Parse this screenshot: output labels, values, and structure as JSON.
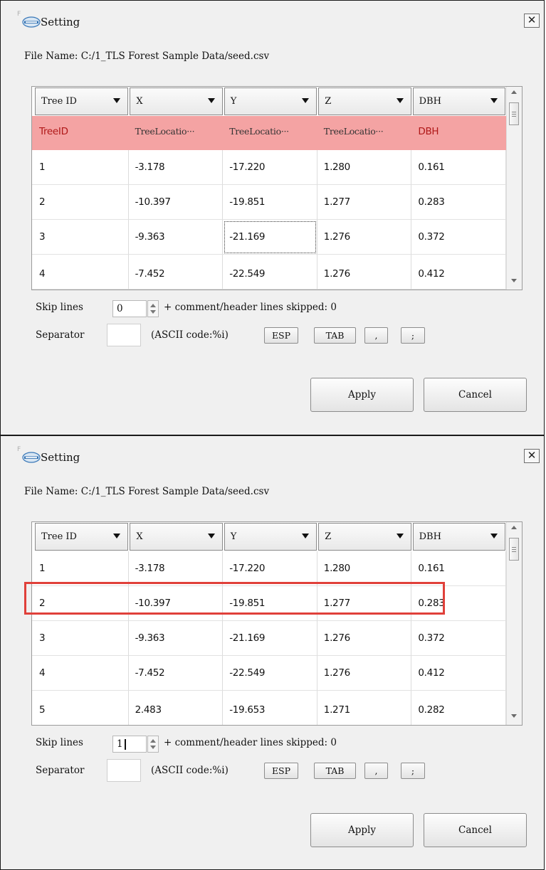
{
  "dialogs": [
    {
      "corner_mark": "F",
      "title": "Setting",
      "file_label": "File Name:",
      "file_path": "C:/1_TLS Forest Sample Data/seed.csv",
      "columns": [
        "Tree ID",
        "X",
        "Y",
        "Z",
        "DBH"
      ],
      "mapping_row": [
        "TreeID",
        "TreeLocatio···",
        "TreeLocatio···",
        "TreeLocatio···",
        "DBH"
      ],
      "rows": [
        [
          "1",
          "-3.178",
          "-17.220",
          "1.280",
          "0.161"
        ],
        [
          "2",
          "-10.397",
          "-19.851",
          "1.277",
          "0.283"
        ],
        [
          "3",
          "-9.363",
          "-21.169",
          "1.276",
          "0.372"
        ],
        [
          "4",
          "-7.452",
          "-22.549",
          "1.276",
          "0.412"
        ]
      ],
      "skip_label": "Skip lines",
      "skip_value": "0",
      "skip_note": "+ comment/header lines skipped: 0",
      "separator_label": "Separator",
      "separator_value": "",
      "ascii_label": "(ASCII code:%i)",
      "sep_buttons": [
        "ESP",
        "TAB",
        ",",
        ";"
      ],
      "apply_label": "Apply",
      "cancel_label": "Cancel",
      "close_glyph": "✕"
    },
    {
      "corner_mark": "F",
      "title": "Setting",
      "file_label": "File Name:",
      "file_path": "C:/1_TLS Forest Sample Data/seed.csv",
      "columns": [
        "Tree ID",
        "X",
        "Y",
        "Z",
        "DBH"
      ],
      "rows": [
        [
          "1",
          "-3.178",
          "-17.220",
          "1.280",
          "0.161"
        ],
        [
          "2",
          "-10.397",
          "-19.851",
          "1.277",
          "0.283"
        ],
        [
          "3",
          "-9.363",
          "-21.169",
          "1.276",
          "0.372"
        ],
        [
          "4",
          "-7.452",
          "-22.549",
          "1.276",
          "0.412"
        ],
        [
          "5",
          "2.483",
          "-19.653",
          "1.271",
          "0.282"
        ]
      ],
      "skip_label": "Skip lines",
      "skip_value": "1",
      "skip_note": "+ comment/header lines skipped: 0",
      "separator_label": "Separator",
      "separator_value": "",
      "ascii_label": "(ASCII code:%i)",
      "sep_buttons": [
        "ESP",
        "TAB",
        ",",
        ";"
      ],
      "apply_label": "Apply",
      "cancel_label": "Cancel",
      "close_glyph": "✕"
    }
  ],
  "colors": {
    "mapping_row_bg": "#f4a3a3",
    "mapping_text": "#b01818",
    "highlight_box": "#e0403a",
    "dialog_bg": "#f0f0f0"
  },
  "icons": [
    "app-logo-icon",
    "close-icon",
    "dropdown-arrow-icon",
    "spin-up-icon",
    "spin-down-icon",
    "scroll-up-icon",
    "scroll-down-icon"
  ]
}
